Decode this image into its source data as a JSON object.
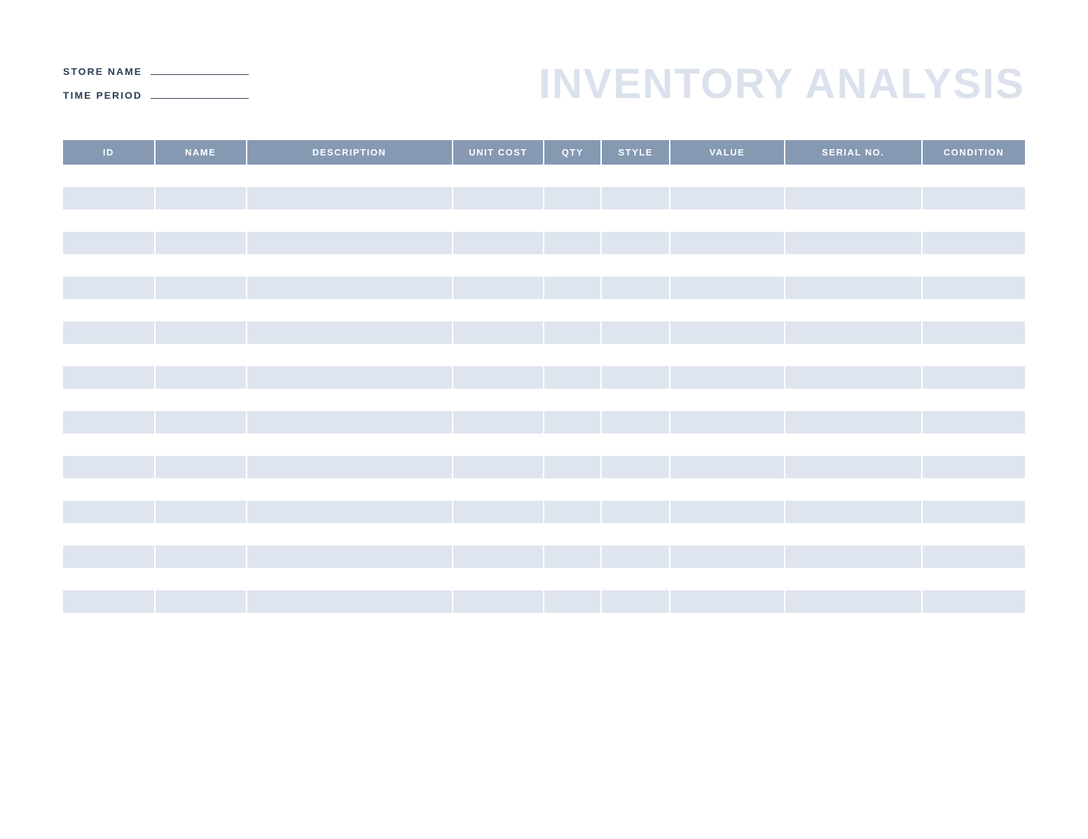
{
  "header": {
    "title": "INVENTORY ANALYSIS",
    "fields": {
      "store_name_label": "STORE NAME",
      "store_name_value": "",
      "time_period_label": "TIME PERIOD",
      "time_period_value": ""
    }
  },
  "table": {
    "columns": [
      "ID",
      "NAME",
      "DESCRIPTION",
      "UNIT COST",
      "QTY",
      "STYLE",
      "VALUE",
      "SERIAL NO.",
      "CONDITION"
    ],
    "rows": [
      [
        "",
        "",
        "",
        "",
        "",
        "",
        "",
        "",
        ""
      ],
      [
        "",
        "",
        "",
        "",
        "",
        "",
        "",
        "",
        ""
      ],
      [
        "",
        "",
        "",
        "",
        "",
        "",
        "",
        "",
        ""
      ],
      [
        "",
        "",
        "",
        "",
        "",
        "",
        "",
        "",
        ""
      ],
      [
        "",
        "",
        "",
        "",
        "",
        "",
        "",
        "",
        ""
      ],
      [
        "",
        "",
        "",
        "",
        "",
        "",
        "",
        "",
        ""
      ],
      [
        "",
        "",
        "",
        "",
        "",
        "",
        "",
        "",
        ""
      ],
      [
        "",
        "",
        "",
        "",
        "",
        "",
        "",
        "",
        ""
      ],
      [
        "",
        "",
        "",
        "",
        "",
        "",
        "",
        "",
        ""
      ],
      [
        "",
        "",
        "",
        "",
        "",
        "",
        "",
        "",
        ""
      ],
      [
        "",
        "",
        "",
        "",
        "",
        "",
        "",
        "",
        ""
      ],
      [
        "",
        "",
        "",
        "",
        "",
        "",
        "",
        "",
        ""
      ],
      [
        "",
        "",
        "",
        "",
        "",
        "",
        "",
        "",
        ""
      ],
      [
        "",
        "",
        "",
        "",
        "",
        "",
        "",
        "",
        ""
      ],
      [
        "",
        "",
        "",
        "",
        "",
        "",
        "",
        "",
        ""
      ],
      [
        "",
        "",
        "",
        "",
        "",
        "",
        "",
        "",
        ""
      ],
      [
        "",
        "",
        "",
        "",
        "",
        "",
        "",
        "",
        ""
      ],
      [
        "",
        "",
        "",
        "",
        "",
        "",
        "",
        "",
        ""
      ],
      [
        "",
        "",
        "",
        "",
        "",
        "",
        "",
        "",
        ""
      ],
      [
        "",
        "",
        "",
        "",
        "",
        "",
        "",
        "",
        ""
      ]
    ]
  },
  "colors": {
    "header_bg": "#8699b3",
    "row_alt_bg": "#dfe5ef",
    "title_color": "#dbe2ed",
    "label_color": "#2b3a55"
  }
}
